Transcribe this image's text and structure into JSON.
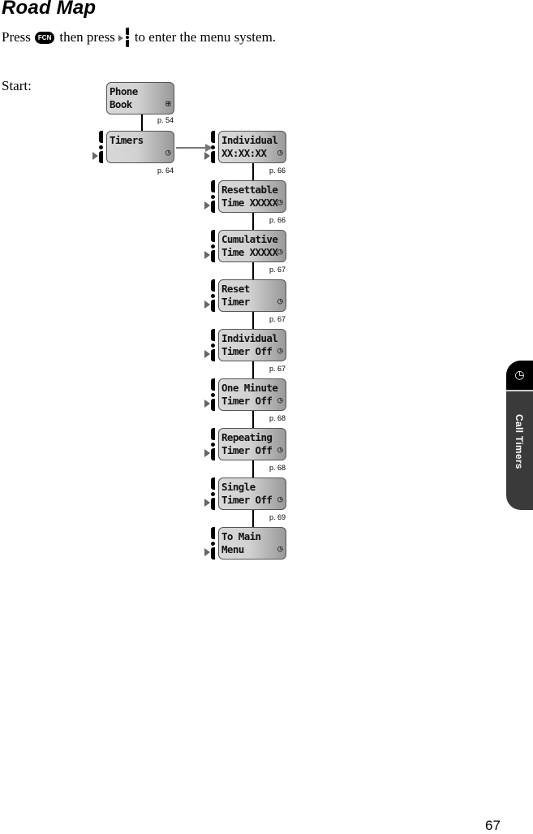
{
  "title": "Road Map",
  "intro": {
    "before": "Press",
    "key_label": "FCN",
    "middle": "then press",
    "after": "to enter the menu system."
  },
  "start_label": "Start:",
  "root": {
    "line1": "Phone",
    "line2": "Book",
    "icon": "phonebook-icon",
    "page": "p. 54"
  },
  "timers": {
    "line1": "Timers",
    "line2": "",
    "icon": "clock-icon",
    "page": "p. 64"
  },
  "submenu": [
    {
      "line1": "Individual",
      "line2": "XX:XX:XX",
      "page": "p. 66"
    },
    {
      "line1": "Resettable",
      "line2": "Time XXXXX",
      "page": "p. 66"
    },
    {
      "line1": "Cumulative",
      "line2": "Time XXXXX",
      "page": "p. 67"
    },
    {
      "line1": "Reset",
      "line2": "Timer",
      "page": "p. 67"
    },
    {
      "line1": "Individual",
      "line2": "Timer Off",
      "page": "p. 67"
    },
    {
      "line1": "One Minute",
      "line2": "Timer Off",
      "page": "p. 68"
    },
    {
      "line1": "Repeating",
      "line2": "Timer Off",
      "page": "p. 68"
    },
    {
      "line1": "Single",
      "line2": "Timer Off",
      "page": "p. 69"
    },
    {
      "line1": "To Main",
      "line2": "Menu",
      "page": ""
    }
  ],
  "glyphs": {
    "clock": "◷",
    "book": "⊞"
  },
  "side_tab": {
    "label": "Call Timers",
    "icon": "clock-icon"
  },
  "page_number": "67"
}
